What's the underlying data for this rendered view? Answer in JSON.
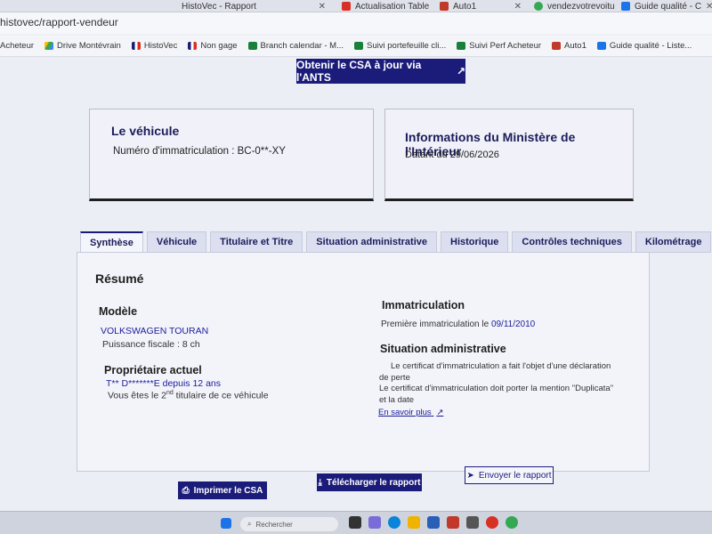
{
  "browser": {
    "tabs": [
      {
        "title": "HistoVec - Rapport",
        "color": "#ffffff"
      },
      {
        "title": "Actualisation Table",
        "color": "#d93025"
      },
      {
        "title": "Auto1",
        "color": "#c0392b"
      },
      {
        "title": "vendezvotrevoitu",
        "color": "#34a853"
      },
      {
        "title": "Guide qualité - C",
        "color": "#1a73e8"
      }
    ],
    "url": "histovec/rapport-vendeur",
    "bookmarks": [
      {
        "label": "Acheteur",
        "color": "#5f6368"
      },
      {
        "label": "Drive Montévrain",
        "color": "#fbbc04"
      },
      {
        "label": "HistoVec",
        "color": "#1b1c7a"
      },
      {
        "label": "Non gage",
        "color": "#1b1c7a"
      },
      {
        "label": "Branch calendar - M...",
        "color": "#188038"
      },
      {
        "label": "Suivi portefeuille cli...",
        "color": "#188038"
      },
      {
        "label": "Suivi Perf Acheteur",
        "color": "#188038"
      },
      {
        "label": "Auto1",
        "color": "#c0392b"
      },
      {
        "label": "Guide qualité - Liste...",
        "color": "#1a73e8"
      }
    ]
  },
  "csa_button": "Obtenir le CSA à jour via l'ANTS",
  "vehicle_card": {
    "title": "Le véhicule",
    "text": "Numéro d'immatriculation : BC-0**-XY"
  },
  "ministry_card": {
    "title": "Informations du Ministère de l'Intérieur",
    "text": "Datant du 29/06/2026"
  },
  "tabs": [
    "Synthèse",
    "Véhicule",
    "Titulaire et Titre",
    "Situation administrative",
    "Historique",
    "Contrôles techniques",
    "Kilométrage"
  ],
  "summary": {
    "heading": "Résumé",
    "model_heading": "Modèle",
    "model_name": "VOLKSWAGEN TOURAN",
    "fiscal_power": "Puissance fiscale : 8 ch",
    "owner_heading": "Propriétaire actuel",
    "owner_name": "T** D*******E depuis 12 ans",
    "owner_rank_prefix": "Vous êtes le 2",
    "owner_rank_sup": "nd",
    "owner_rank_suffix": " titulaire de ce véhicule",
    "immat_heading": "Immatriculation",
    "immat_first_prefix": "Première immatriculation le ",
    "immat_first_date": "09/11/2010",
    "admin_heading": "Situation administrative",
    "admin_line1": "Le certificat d'immatriculation a fait l'objet d'une déclaration",
    "admin_line2": "de perte",
    "admin_line3": "Le certificat d'immatriculation doit porter la mention \"Duplicata\"",
    "admin_line4": "et la date",
    "learn_more": "En savoir plus"
  },
  "actions": {
    "print": "Imprimer le CSA",
    "download": "Télécharger le rapport",
    "send": "Envoyer le rapport"
  },
  "taskbar": {
    "search_placeholder": "Rechercher"
  }
}
